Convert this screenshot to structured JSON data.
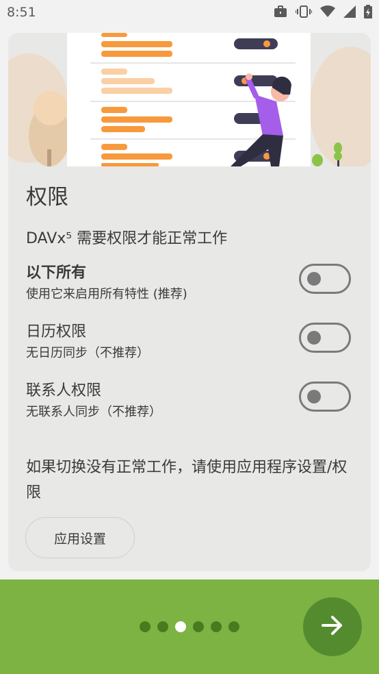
{
  "status_bar": {
    "time": "8:51"
  },
  "permissions": {
    "title": "权限",
    "subtitle": "DAVx⁵ 需要权限才能正常工作",
    "items": [
      {
        "title": "以下所有",
        "description": "使用它来启用所有特性 (推荐)",
        "enabled": false
      },
      {
        "title": "日历权限",
        "description": "无日历同步（不推荐）",
        "enabled": false
      },
      {
        "title": "联系人权限",
        "description": "无联系人同步（不推荐）",
        "enabled": false
      }
    ],
    "note": "如果切换没有正常工作，请使用应用程序设置/权限",
    "app_settings_label": "应用设置"
  },
  "pager": {
    "page_count": 6,
    "current_page": 3
  },
  "colors": {
    "accent": "#7cb342",
    "fab": "#558b2f",
    "illustration_orange": "#f79a3e",
    "illustration_purple": "#a45eea"
  }
}
